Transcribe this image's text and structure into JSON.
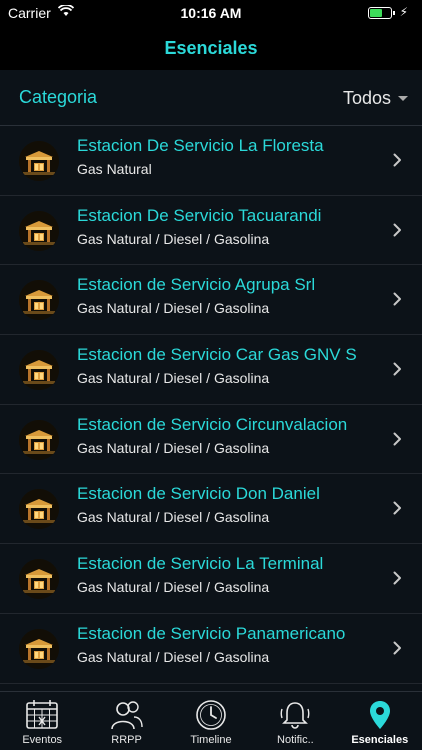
{
  "status_bar": {
    "carrier": "Carrier",
    "time": "10:16 AM"
  },
  "nav": {
    "title": "Esenciales"
  },
  "filter": {
    "label": "Categoria",
    "selected": "Todos"
  },
  "stations": [
    {
      "name": "Estacion De Servicio La Floresta",
      "fuels": "Gas Natural"
    },
    {
      "name": "Estacion De Servicio Tacuarandi",
      "fuels": "Gas Natural / Diesel / Gasolina"
    },
    {
      "name": "Estacion de Servicio Agrupa Srl",
      "fuels": "Gas Natural / Diesel / Gasolina"
    },
    {
      "name": "Estacion de Servicio Car Gas GNV S",
      "fuels": "Gas Natural / Diesel / Gasolina"
    },
    {
      "name": "Estacion de Servicio Circunvalacion",
      "fuels": "Gas Natural / Diesel / Gasolina"
    },
    {
      "name": "Estacion de Servicio Don Daniel",
      "fuels": "Gas Natural / Diesel / Gasolina"
    },
    {
      "name": "Estacion de Servicio La Terminal",
      "fuels": "Gas Natural / Diesel / Gasolina"
    },
    {
      "name": "Estacion de Servicio Panamericano",
      "fuels": "Gas Natural / Diesel / Gasolina"
    }
  ],
  "tabs": [
    {
      "label": "Eventos",
      "icon": "calendar-icon"
    },
    {
      "label": "RRPP",
      "icon": "people-icon"
    },
    {
      "label": "Timeline",
      "icon": "clock-icon"
    },
    {
      "label": "Notific..",
      "icon": "bell-icon"
    },
    {
      "label": "Esenciales",
      "icon": "location-pin-icon",
      "active": true
    }
  ],
  "colors": {
    "accent": "#2bd9d9",
    "background": "#0c1218",
    "bar_background": "#000000",
    "battery": "#3ddc5a"
  }
}
